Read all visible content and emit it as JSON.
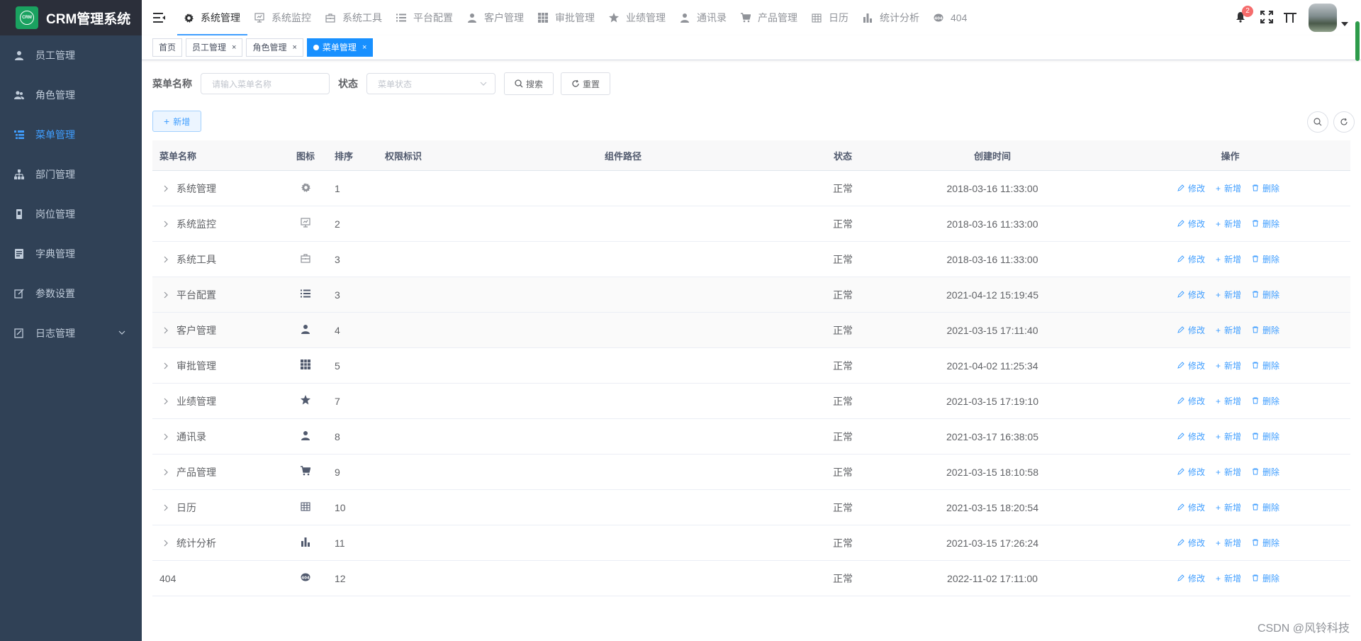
{
  "app": {
    "title": "CRM管理系统",
    "logo_text": "CRM"
  },
  "sidebar": {
    "items": [
      {
        "label": "员工管理",
        "icon": "user-icon"
      },
      {
        "label": "角色管理",
        "icon": "peoples-icon"
      },
      {
        "label": "菜单管理",
        "icon": "tree-table-icon",
        "active": true
      },
      {
        "label": "部门管理",
        "icon": "tree-icon"
      },
      {
        "label": "岗位管理",
        "icon": "post-icon"
      },
      {
        "label": "字典管理",
        "icon": "dict-icon"
      },
      {
        "label": "参数设置",
        "icon": "edit-icon"
      },
      {
        "label": "日志管理",
        "icon": "log-icon",
        "has_children": true
      }
    ]
  },
  "topnav": {
    "items": [
      {
        "label": "系统管理",
        "icon": "gear-icon",
        "active": true
      },
      {
        "label": "系统监控",
        "icon": "monitor-icon"
      },
      {
        "label": "系统工具",
        "icon": "toolbox-icon"
      },
      {
        "label": "平台配置",
        "icon": "list-icon"
      },
      {
        "label": "客户管理",
        "icon": "user-icon"
      },
      {
        "label": "审批管理",
        "icon": "grid-icon"
      },
      {
        "label": "业绩管理",
        "icon": "star-icon"
      },
      {
        "label": "通讯录",
        "icon": "user-icon"
      },
      {
        "label": "产品管理",
        "icon": "cart-icon"
      },
      {
        "label": "日历",
        "icon": "calendar-icon"
      },
      {
        "label": "统计分析",
        "icon": "bar-chart-icon"
      },
      {
        "label": "404",
        "icon": "404-icon"
      }
    ],
    "notification_count": "2"
  },
  "tags": [
    {
      "label": "首页",
      "closable": false
    },
    {
      "label": "员工管理",
      "closable": true
    },
    {
      "label": "角色管理",
      "closable": true
    },
    {
      "label": "菜单管理",
      "closable": true,
      "active": true
    }
  ],
  "search": {
    "name_label": "菜单名称",
    "name_placeholder": "请输入菜单名称",
    "status_label": "状态",
    "status_placeholder": "菜单状态",
    "search_button": "搜索",
    "reset_button": "重置"
  },
  "toolbar": {
    "add_button": "新增"
  },
  "table": {
    "columns": [
      "菜单名称",
      "图标",
      "排序",
      "权限标识",
      "组件路径",
      "状态",
      "创建时间",
      "操作"
    ],
    "rows": [
      {
        "name": "系统管理",
        "icon": "gear-icon",
        "order": "1",
        "perms": "",
        "component": "",
        "status": "正常",
        "created": "2018-03-16 11:33:00",
        "expandable": true
      },
      {
        "name": "系统监控",
        "icon": "monitor-icon",
        "order": "2",
        "perms": "",
        "component": "",
        "status": "正常",
        "created": "2018-03-16 11:33:00",
        "expandable": true
      },
      {
        "name": "系统工具",
        "icon": "toolbox-icon",
        "order": "3",
        "perms": "",
        "component": "",
        "status": "正常",
        "created": "2018-03-16 11:33:00",
        "expandable": true
      },
      {
        "name": "平台配置",
        "icon": "list-icon",
        "order": "3",
        "perms": "",
        "component": "",
        "status": "正常",
        "created": "2021-04-12 15:19:45",
        "expandable": true
      },
      {
        "name": "客户管理",
        "icon": "user-icon",
        "order": "4",
        "perms": "",
        "component": "",
        "status": "正常",
        "created": "2021-03-15 17:11:40",
        "expandable": true,
        "highlight": true
      },
      {
        "name": "审批管理",
        "icon": "grid-icon",
        "order": "5",
        "perms": "",
        "component": "",
        "status": "正常",
        "created": "2021-04-02 11:25:34",
        "expandable": true
      },
      {
        "name": "业绩管理",
        "icon": "star-icon",
        "order": "7",
        "perms": "",
        "component": "",
        "status": "正常",
        "created": "2021-03-15 17:19:10",
        "expandable": true
      },
      {
        "name": "通讯录",
        "icon": "user-icon",
        "order": "8",
        "perms": "",
        "component": "",
        "status": "正常",
        "created": "2021-03-17 16:38:05",
        "expandable": true
      },
      {
        "name": "产品管理",
        "icon": "cart-icon",
        "order": "9",
        "perms": "",
        "component": "",
        "status": "正常",
        "created": "2021-03-15 18:10:58",
        "expandable": true
      },
      {
        "name": "日历",
        "icon": "calendar-icon",
        "order": "10",
        "perms": "",
        "component": "",
        "status": "正常",
        "created": "2021-03-15 18:20:54",
        "expandable": true
      },
      {
        "name": "统计分析",
        "icon": "bar-chart-icon",
        "order": "11",
        "perms": "",
        "component": "",
        "status": "正常",
        "created": "2021-03-15 17:26:24",
        "expandable": true
      },
      {
        "name": "404",
        "icon": "404-icon",
        "order": "12",
        "perms": "",
        "component": "",
        "status": "正常",
        "created": "2022-11-02 17:11:00",
        "expandable": false
      }
    ],
    "actions": {
      "edit": "修改",
      "add": "新增",
      "delete": "删除"
    }
  },
  "watermark": "CSDN @风铃科技",
  "colors": {
    "sidebar_bg": "#304156",
    "accent": "#409eff",
    "active_tag": "#1890ff"
  }
}
